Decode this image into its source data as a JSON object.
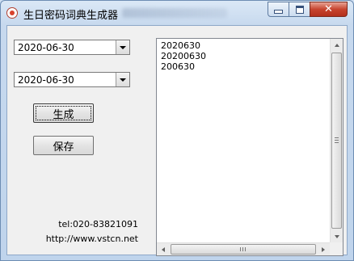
{
  "window": {
    "title": "生日密码词典生成器",
    "controls": {
      "minimize_icon": "minimize-icon",
      "maximize_icon": "maximize-icon",
      "close_glyph": "✕"
    }
  },
  "form": {
    "start_date": {
      "value": "2020-06-30"
    },
    "end_date": {
      "value": "2020-06-30"
    },
    "generate_label": "生成",
    "save_label": "保存",
    "tel": "tel:020-83821091",
    "url": "http://www.vstcn.net"
  },
  "output": {
    "lines": [
      "2020630",
      "20200630",
      "200630"
    ]
  },
  "colors": {
    "close_button": "#c7442f",
    "title_bar": "#c7d9ee"
  }
}
